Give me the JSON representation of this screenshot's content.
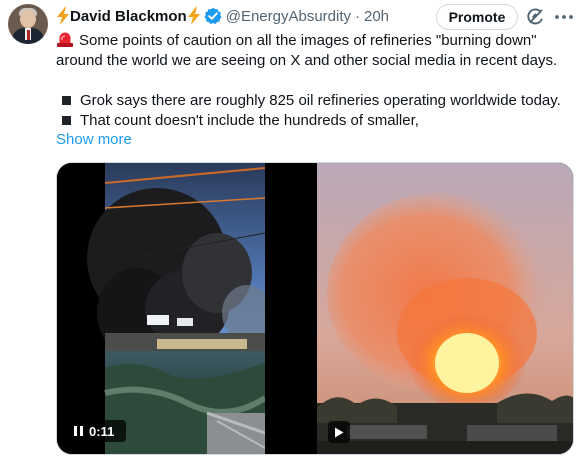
{
  "author": {
    "name": "David Blackmon",
    "handle": "@EnergyAbsurdity",
    "separator": "·",
    "time": "20h"
  },
  "actions": {
    "promote_label": "Promote"
  },
  "tweet": {
    "line1": "Some points of caution on all the images of refineries \"burning down\"",
    "line2": "around the world we are seeing on X and other social media in recent days.",
    "bullet1": "Grok says there are roughly 825 oil refineries operating worldwide today.",
    "bullet2": "That count doesn't include the hundreds of smaller,",
    "show_more": "Show more"
  },
  "media": {
    "video1_duration": "0:11"
  },
  "icons": {
    "bolt": "high-voltage-icon",
    "verified": "verified-badge-icon",
    "siren": "police-light-icon",
    "grok": "grok-icon",
    "more": "more-icon",
    "pause": "pause-icon",
    "play": "play-icon"
  },
  "colors": {
    "link": "#1d9bf0",
    "secondary_text": "#536471",
    "bolt": "#f4a31c",
    "verified": "#1d9bf0"
  }
}
